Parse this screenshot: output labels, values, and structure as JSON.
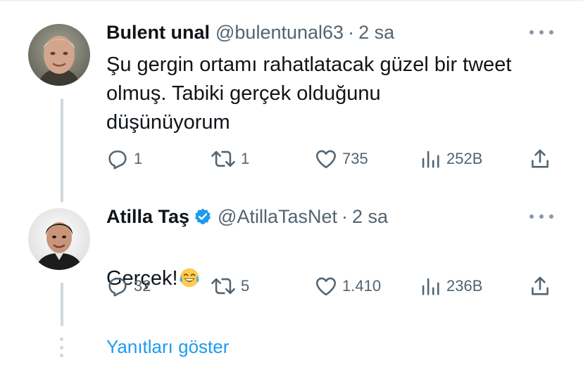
{
  "tweets": [
    {
      "display_name": "Bulent unal",
      "handle": "@bulentunal63",
      "separator": "·",
      "time": "2 sa",
      "verified": false,
      "avatar_icon": "person-photo-icon",
      "text": "Şu gergin ortamı rahatlatacak güzel bir tweet\nolmuş. Tabiki gerçek olduğunu\ndüşünüyorum",
      "replies": "1",
      "retweets": "1",
      "likes": "735",
      "views": "252B"
    },
    {
      "display_name": "Atilla Taş",
      "handle": "@AtillaTasNet",
      "separator": "·",
      "time": "2 sa",
      "verified": true,
      "avatar_icon": "person-photo-icon",
      "text": "Gerçek!",
      "text_emoji": "face-with-tears-of-joy-emoji",
      "replies": "32",
      "retweets": "5",
      "likes": "1.410",
      "views": "236B"
    }
  ],
  "show_replies_label": "Yanıtları göster",
  "colors": {
    "text_primary": "#0f1419",
    "text_secondary": "#536471",
    "link": "#1d9bf0",
    "verified_badge": "#1d9bf0",
    "thread_line": "#cfd9de",
    "emoji_yellow": "#ffcc4d"
  }
}
